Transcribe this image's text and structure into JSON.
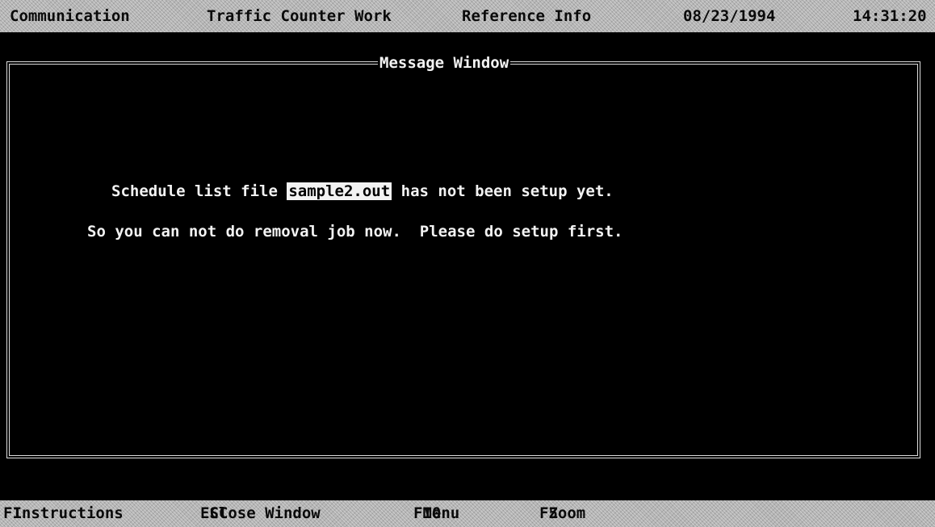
{
  "menu": {
    "items": [
      "Communication",
      "Traffic Counter Work",
      "Reference Info"
    ],
    "date": "08/23/1994",
    "time": "14:31:20"
  },
  "window": {
    "title": "Message Window",
    "line1_before": "Schedule list file ",
    "filename": "sample2.out",
    "line1_after": " has not been setup yet.",
    "line2": "So you can not do removal job now.  Please do setup first."
  },
  "status": {
    "keys": [
      {
        "key": "F1",
        "label": "Instructions"
      },
      {
        "key": "ESC",
        "label": "Close Window"
      },
      {
        "key": "F10",
        "label": "Menu"
      },
      {
        "key": "F5",
        "label": "Zoom"
      }
    ]
  }
}
